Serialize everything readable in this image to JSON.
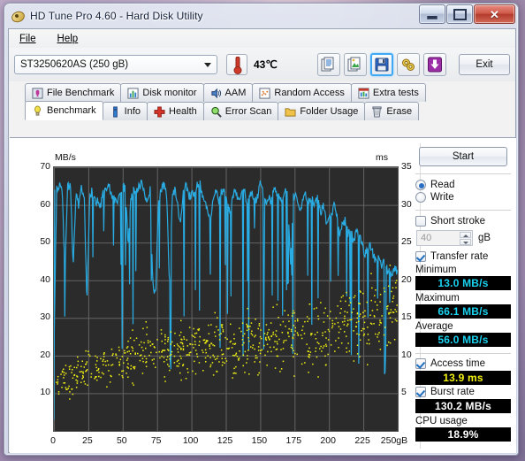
{
  "window": {
    "title": "HD Tune Pro 4.60 - Hard Disk Utility",
    "app_icon": "hdtune-disk-icon",
    "minimize_label": "–",
    "maximize_label": "□",
    "close_label": "✕"
  },
  "menu": {
    "items": [
      {
        "label": "File"
      },
      {
        "label": "Help"
      }
    ]
  },
  "toolbar": {
    "drive": "ST3250620AS (250 gB)",
    "temperature": "43℃",
    "thermometer_icon": "thermometer-icon",
    "buttons": [
      {
        "name": "copy-text-button",
        "icon": "copy-text-icon"
      },
      {
        "name": "copy-screenshot-button",
        "icon": "copy-image-icon"
      },
      {
        "name": "save-button",
        "icon": "floppy-disk-icon",
        "selected": true
      },
      {
        "name": "settings-button",
        "icon": "gears-icon"
      },
      {
        "name": "download-button",
        "icon": "purple-down-arrow-icon"
      }
    ],
    "exit_label": "Exit"
  },
  "tabs": {
    "top_row": [
      {
        "label": "File Benchmark",
        "icon": "file-benchmark-icon"
      },
      {
        "label": "Disk monitor",
        "icon": "bar-chart-icon"
      },
      {
        "label": "AAM",
        "icon": "speaker-icon"
      },
      {
        "label": "Random Access",
        "icon": "scatter-icon"
      },
      {
        "label": "Extra tests",
        "icon": "extra-tests-icon"
      }
    ],
    "bottom_row": [
      {
        "label": "Benchmark",
        "icon": "lightbulb-icon",
        "active": true
      },
      {
        "label": "Info",
        "icon": "info-icon"
      },
      {
        "label": "Health",
        "icon": "red-cross-icon"
      },
      {
        "label": "Error Scan",
        "icon": "magnifier-icon"
      },
      {
        "label": "Folder Usage",
        "icon": "folder-icon"
      },
      {
        "label": "Erase",
        "icon": "trash-icon"
      }
    ]
  },
  "results": {
    "start_label": "Start",
    "mode": [
      {
        "label": "Read",
        "selected": true
      },
      {
        "label": "Write",
        "selected": false
      }
    ],
    "short_stroke": {
      "label": "Short stroke",
      "checked": false,
      "value": "40",
      "unit": "gB"
    },
    "transfer_rate": {
      "label": "Transfer rate",
      "checked": true
    },
    "minimum": {
      "label": "Minimum",
      "value": "13.0 MB/s"
    },
    "maximum": {
      "label": "Maximum",
      "value": "66.1 MB/s"
    },
    "average": {
      "label": "Average",
      "value": "56.0 MB/s"
    },
    "access_time": {
      "label": "Access time",
      "checked": true,
      "value": "13.9 ms"
    },
    "burst_rate": {
      "label": "Burst rate",
      "checked": true,
      "value": "130.2 MB/s"
    },
    "cpu_usage": {
      "label": "CPU usage",
      "value": "18.9%"
    }
  },
  "chart_data": {
    "type": "line",
    "title": "",
    "left_axis_label": "MB/s",
    "right_axis_label": "ms",
    "xlabel": "gB",
    "xlim": [
      0,
      250
    ],
    "ylim": [
      0,
      70
    ],
    "y2lim": [
      0,
      35
    ],
    "grid": true,
    "background": "#2b2b2b",
    "gridline_color": "#6e6e6e",
    "xticks": [
      "0",
      "25",
      "50",
      "75",
      "100",
      "125",
      "150",
      "175",
      "200",
      "225",
      "250gB"
    ],
    "xtick_values": [
      0,
      25,
      50,
      75,
      100,
      125,
      150,
      175,
      200,
      225,
      250
    ],
    "yticks": [
      "10",
      "20",
      "30",
      "40",
      "50",
      "60",
      "70"
    ],
    "ytick_values": [
      10,
      20,
      30,
      40,
      50,
      60,
      70
    ],
    "y2ticks": [
      "5",
      "10",
      "15",
      "20",
      "25",
      "30",
      "35"
    ],
    "y2tick_values": [
      5,
      10,
      15,
      20,
      25,
      30,
      35
    ],
    "series": [
      {
        "name": "Transfer rate",
        "type": "line",
        "color": "#29ace3",
        "axis": "left",
        "units": "MB/s",
        "x": [
          0,
          2,
          4,
          6,
          8,
          10,
          12,
          14,
          16,
          18,
          20,
          22,
          24,
          26,
          28,
          30,
          32,
          34,
          36,
          38,
          40,
          42,
          44,
          46,
          48,
          50,
          52,
          54,
          56,
          58,
          60,
          62,
          64,
          66,
          68,
          70,
          72,
          74,
          76,
          78,
          80,
          82,
          84,
          86,
          88,
          90,
          92,
          94,
          96,
          98,
          100,
          102,
          104,
          106,
          108,
          110,
          112,
          114,
          116,
          118,
          120,
          122,
          124,
          126,
          128,
          130,
          132,
          134,
          136,
          138,
          140,
          142,
          144,
          146,
          148,
          150,
          152,
          154,
          156,
          158,
          160,
          162,
          164,
          166,
          168,
          170,
          172,
          174,
          176,
          178,
          180,
          182,
          184,
          186,
          188,
          190,
          192,
          194,
          196,
          198,
          200,
          202,
          204,
          206,
          208,
          210,
          212,
          214,
          216,
          218,
          220,
          222,
          224,
          226,
          228,
          230,
          232,
          234,
          236,
          238,
          240,
          242,
          244,
          246,
          248,
          250
        ],
        "y": [
          20,
          64,
          65,
          64,
          41,
          65,
          65,
          44,
          63,
          60,
          65,
          62,
          34,
          62,
          64,
          61,
          61,
          60,
          63,
          64,
          65,
          63,
          61,
          61,
          63,
          65,
          64,
          50,
          62,
          64,
          63,
          65,
          66,
          63,
          61,
          64,
          38,
          36,
          62,
          64,
          65,
          63,
          38,
          62,
          64,
          60,
          54,
          63,
          65,
          62,
          63,
          62,
          65,
          66,
          62,
          61,
          58,
          55,
          62,
          64,
          61,
          64,
          63,
          60,
          58,
          62,
          64,
          61,
          63,
          65,
          60,
          62,
          63,
          61,
          62,
          66,
          63,
          60,
          62,
          61,
          64,
          63,
          62,
          61,
          64,
          63,
          44,
          62,
          63,
          60,
          59,
          63,
          62,
          61,
          62,
          60,
          62,
          58,
          60,
          55,
          57,
          58,
          60,
          57,
          52,
          55,
          56,
          52,
          54,
          50,
          53,
          52,
          50,
          47,
          48,
          49,
          47,
          45,
          46,
          44,
          45,
          43,
          42,
          41,
          43,
          42
        ]
      },
      {
        "name": "Access time",
        "type": "scatter",
        "color": "#f2f211",
        "axis": "right",
        "units": "ms",
        "description": "Yellow scatter of access times rising from ~5 ms near 0 gB to ~17 ms near 250 gB, with dense spread between 7 and 17 ms"
      }
    ],
    "minimum": 13.0,
    "maximum": 66.1,
    "average": 56.0,
    "access_time_avg": 13.9,
    "burst_rate": 130.2,
    "cpu_usage": 18.9
  }
}
